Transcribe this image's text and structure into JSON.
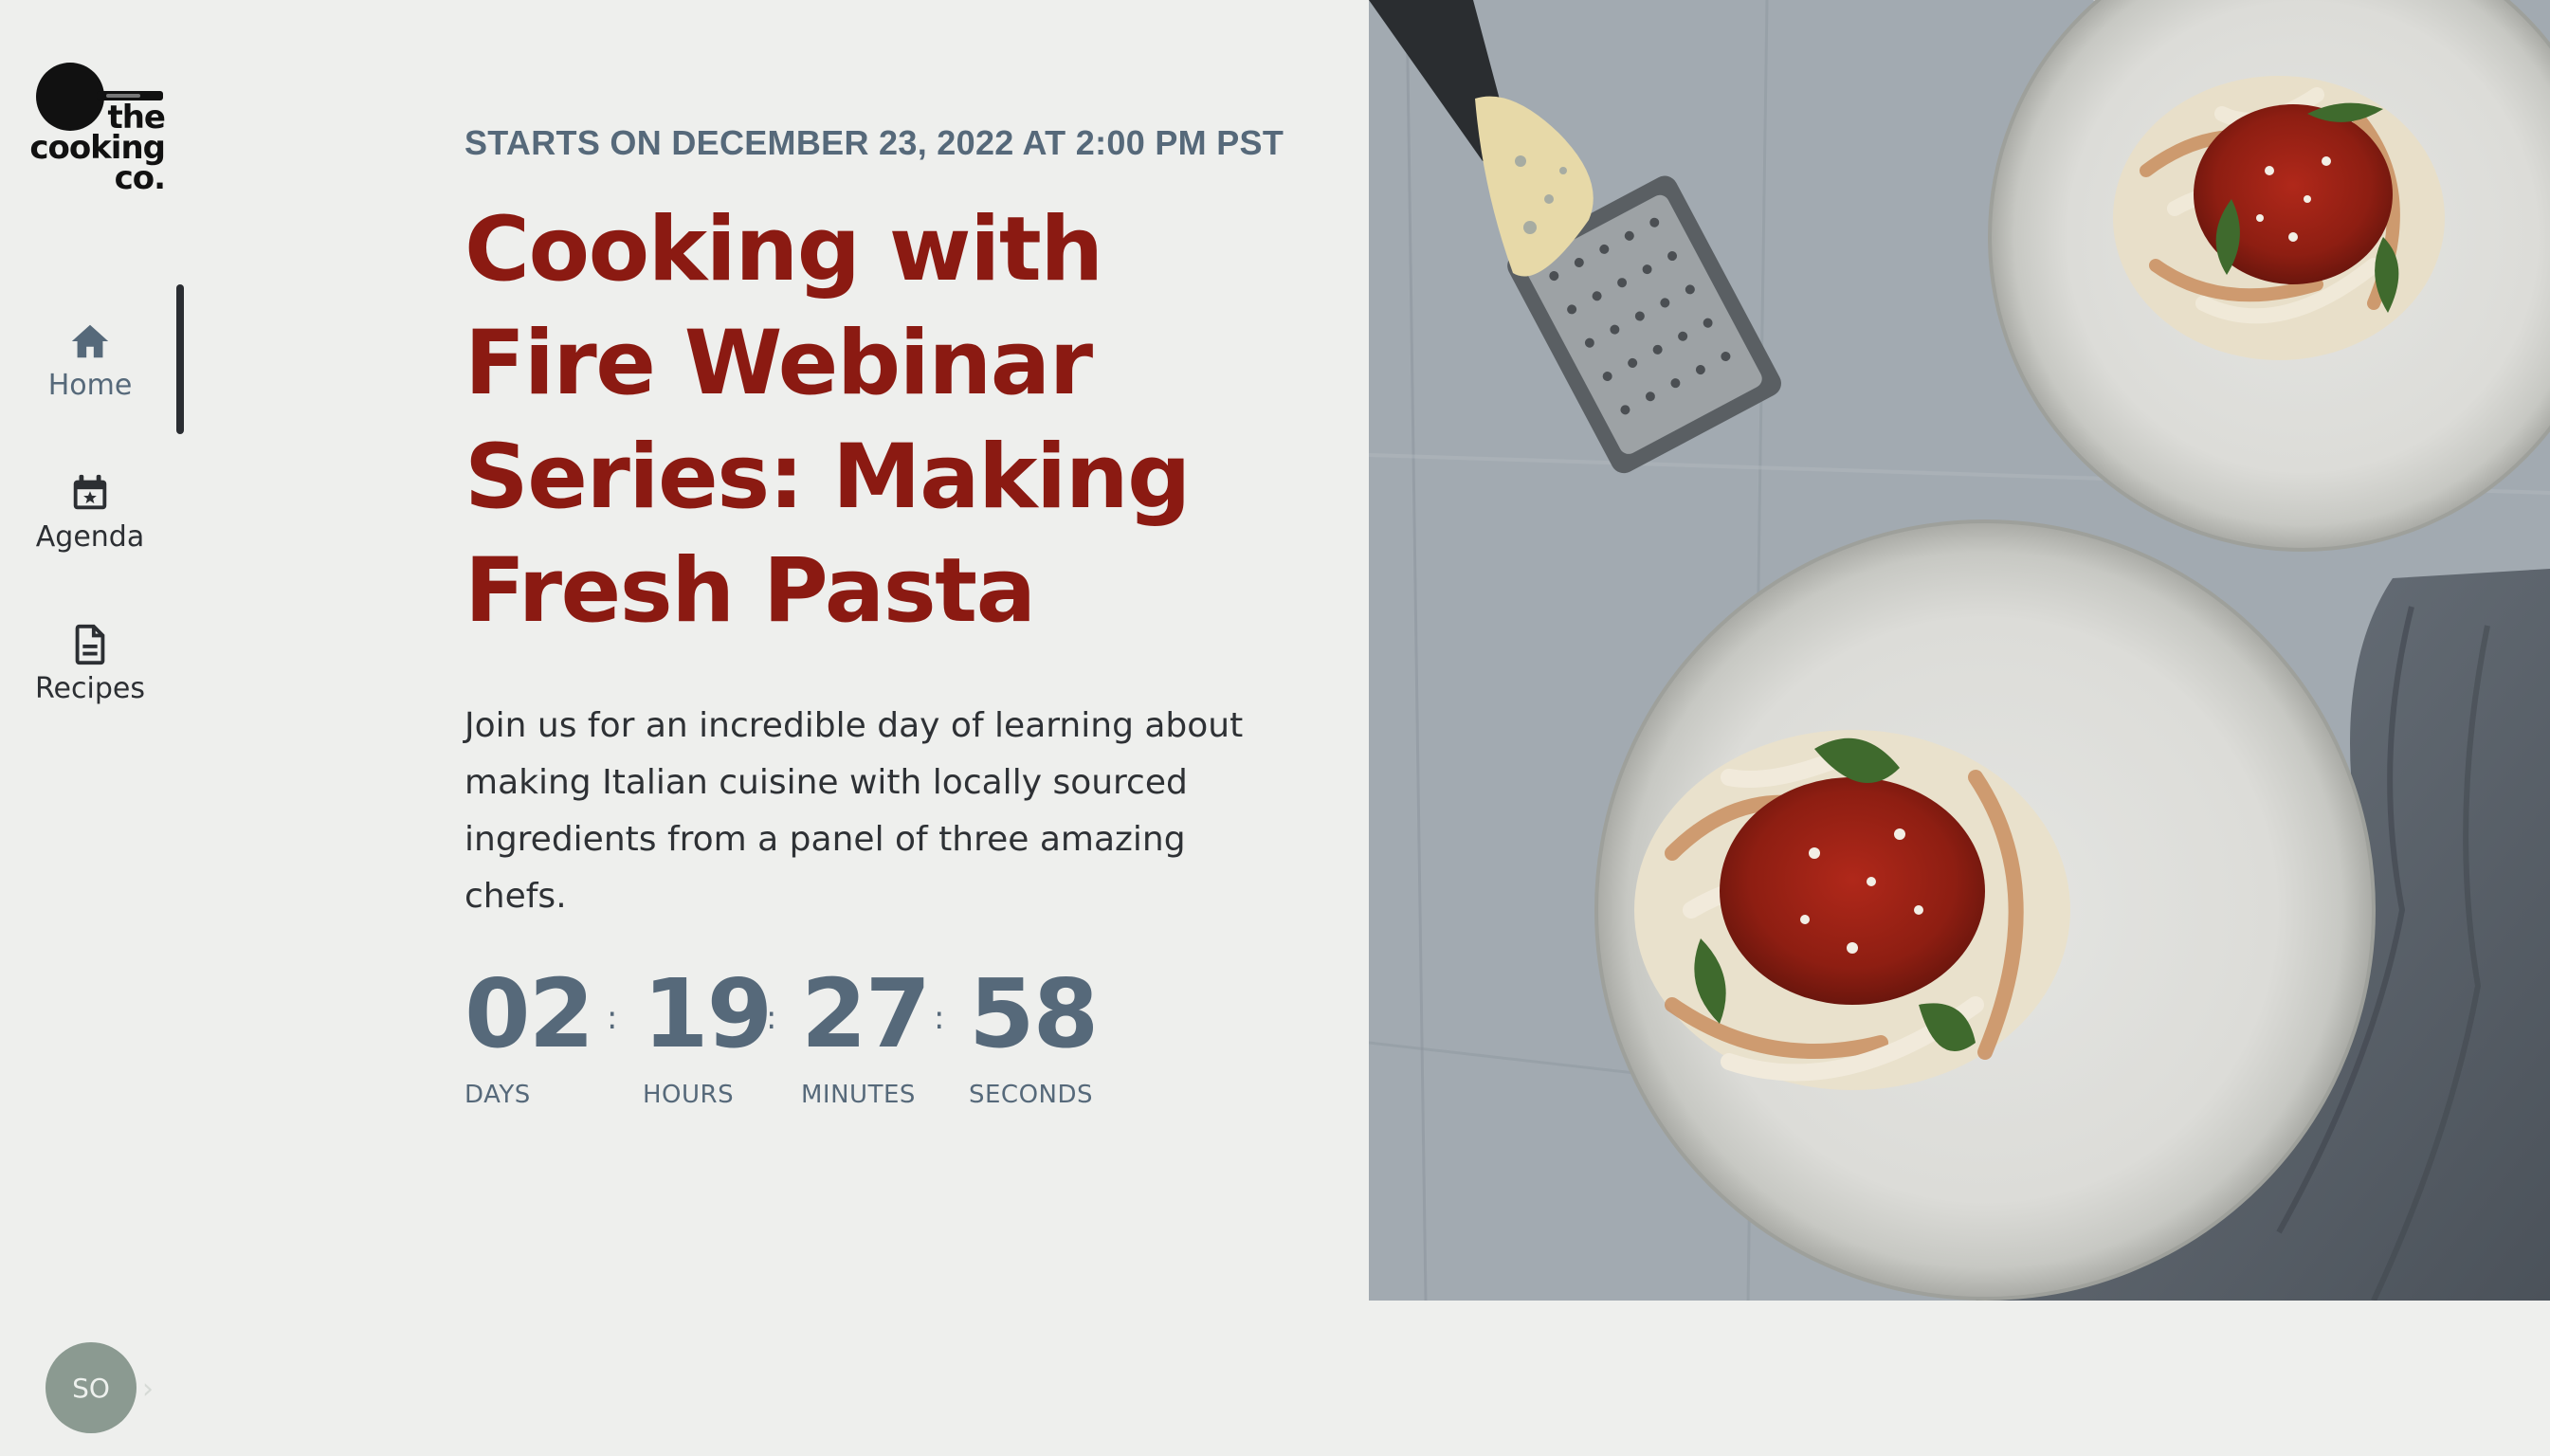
{
  "brand": {
    "logo_text": "the\ncooking\nco."
  },
  "nav": {
    "items": [
      {
        "label": "Home",
        "icon": "home-icon",
        "active": true
      },
      {
        "label": "Agenda",
        "icon": "calendar-star-icon",
        "active": false
      },
      {
        "label": "Recipes",
        "icon": "document-icon",
        "active": false
      }
    ]
  },
  "user": {
    "initials": "SO"
  },
  "event": {
    "starts": "STARTS ON DECEMBER 23, 2022 AT 2:00 PM PST",
    "title": "Cooking with Fire Webinar Series: Making Fresh Pasta",
    "description": "Join us for an incredible day of learning about making Italian cuisine with locally sourced ingredients from a panel of three amazing chefs."
  },
  "countdown": {
    "separator": ":",
    "units": [
      {
        "value": "02",
        "label": "DAYS"
      },
      {
        "value": "19",
        "label": "HOURS"
      },
      {
        "value": "27",
        "label": "MINUTES"
      },
      {
        "value": "58",
        "label": "SECONDS"
      }
    ]
  },
  "colors": {
    "background": "#eeefed",
    "title": "#8b1a12",
    "accent": "#56697a",
    "text": "#2e3135",
    "avatar": "#8b9a91"
  }
}
